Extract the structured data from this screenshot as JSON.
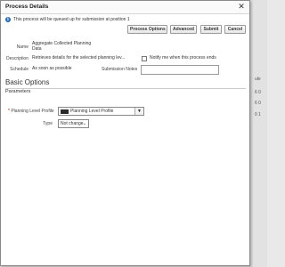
{
  "dialog": {
    "title": "Process Details",
    "close_glyph": "✕",
    "info_message": "This process will be queued up for submission at position 1"
  },
  "buttons": {
    "process_options": "Process Options",
    "advanced": "Advanced",
    "submit": "Submit",
    "cancel": "Cancel"
  },
  "fields": {
    "name_label": "Name",
    "name_value_line1": "Aggregate Collected Planning",
    "name_value_line2": "Data",
    "description_label": "Description",
    "description_value": "Retrieves details for the selected planning lev...",
    "notify_label": "Notify me when this process ends",
    "schedule_label": "Schedule",
    "schedule_value": "As soon as possible",
    "submission_notes_label": "Submission Notes",
    "submission_notes_value": ""
  },
  "section": {
    "title": "Basic Options",
    "subtitle": "Parameters"
  },
  "parameters": {
    "required_mark": "*",
    "planning_level_profile_label": "Planning Level Profile",
    "planning_level_profile_value": "Planning Level Profile",
    "type_label": "Type",
    "type_value": "Not change"
  },
  "background": {
    "texts": [
      "ule",
      "6 0",
      "6 0",
      "0 1"
    ]
  },
  "colors": {
    "accent": "#2b6cb0",
    "required": "#b00000"
  }
}
